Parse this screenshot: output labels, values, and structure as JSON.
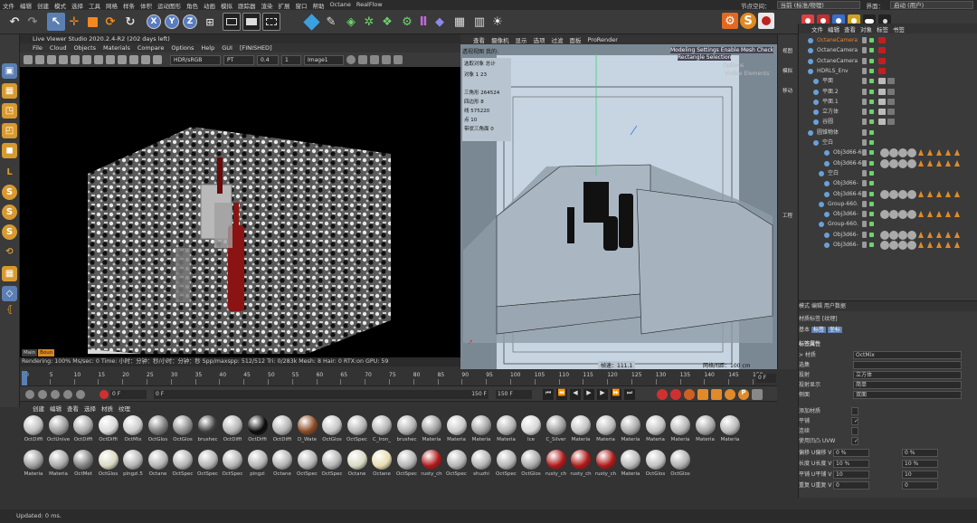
{
  "menubar": {
    "items": [
      "文件",
      "编辑",
      "创建",
      "模式",
      "选择",
      "工具",
      "网格",
      "样条",
      "体积",
      "运动图形",
      "角色",
      "动画",
      "模拟",
      "跟踪器",
      "渲染",
      "扩展",
      "窗口",
      "帮助",
      "Octane",
      "RealFlow"
    ],
    "node_space_label": "节点空间：",
    "node_space_value": "当前 (标准/物理)",
    "interface_label": "界面：",
    "interface_value": "启动 (用户)"
  },
  "toolbar": {
    "icons": [
      "undo-icon",
      "redo-icon",
      "select-icon",
      "move-icon",
      "scale-icon",
      "rotate-icon",
      "recent-tool-icon",
      "x-axis-icon",
      "y-axis-icon",
      "z-axis-icon",
      "coord-system-icon",
      "render-region-icon",
      "render-view-icon",
      "render-settings-icon",
      "cube-icon",
      "pen-icon",
      "subdivision-icon",
      "array-icon",
      "extrude-icon",
      "bend-icon",
      "deformer-icon",
      "floor-icon",
      "camera-icon",
      "light-icon"
    ],
    "axis_x": "X",
    "axis_y": "Y",
    "axis_z": "Z"
  },
  "live_viewer": {
    "title": "Live Viewer Studio 2020.2.4-R2 (202 days left)",
    "menu": [
      "File",
      "Cloud",
      "Objects",
      "Materials",
      "Compare",
      "Options",
      "Help",
      "GUI",
      "[FINISHED]"
    ],
    "color_space": "HDR/sRGB",
    "kernel": "PT",
    "value_a": "0.4",
    "value_b": "1",
    "image_mode": "Image1",
    "tabs": [
      "Main",
      "Boun"
    ],
    "status": "Rendering: 100%   Ms/sec: 0   Time: 小时：分钟：秒/小时：分钟：秒   Spp/maxspp: 512/512   Tri: 0/283k   Mesh: 8   Hair: 0   RTX:on   GPU:   59"
  },
  "viewport": {
    "menu": [
      "查看",
      "摄像机",
      "显示",
      "选项",
      "过滤",
      "面板",
      "ProRender"
    ],
    "view_label": "透视视图",
    "camera_label": "我的:",
    "hud_top": "Modeling Settings Enable Mesh Check",
    "hud_top2": "Rectangle Selection",
    "hud_faded1": "Options",
    "hud_faded2": "Visible Elements",
    "stats": [
      {
        "label": "选取对象",
        "value": "总计"
      },
      {
        "label": "对象",
        "value": "1          23"
      },
      {
        "label": "三角形",
        "value": "264524"
      },
      {
        "label": "四边形",
        "value": "8"
      },
      {
        "label": "线",
        "value": "575220"
      },
      {
        "label": "点",
        "value": "10"
      },
      {
        "label": "带状三角面",
        "value": "0"
      }
    ],
    "speed": "帧速：111.1",
    "grid_spacing": "网格间距：100 cm"
  },
  "viewport_side": [
    "视图",
    "模拟",
    "移动",
    "工程"
  ],
  "object_manager": {
    "tabs": [
      "文件",
      "编辑",
      "查看",
      "对象",
      "标签",
      "书签"
    ],
    "objects": [
      {
        "name": "OctaneCamera",
        "color": "#e8822a",
        "indent": 12
      },
      {
        "name": "OctaneCamera",
        "color": "#cfcfcf",
        "indent": 12
      },
      {
        "name": "OctaneCamera",
        "color": "#cfcfcf",
        "indent": 12
      },
      {
        "name": "HDRLS_Env",
        "color": "#cfcfcf",
        "indent": 12
      },
      {
        "name": "平面",
        "color": "#cfcfcf",
        "indent": 18
      },
      {
        "name": "平面.2",
        "color": "#cfcfcf",
        "indent": 18
      },
      {
        "name": "平面.1",
        "color": "#cfcfcf",
        "indent": 18
      },
      {
        "name": "立方体",
        "color": "#cfcfcf",
        "indent": 18
      },
      {
        "name": "谷圆",
        "color": "#cfcfcf",
        "indent": 18
      },
      {
        "name": "圆锥物体",
        "color": "#cfcfcf",
        "indent": 12
      },
      {
        "name": "空白",
        "color": "#cfcfcf",
        "indent": 18
      },
      {
        "name": "Obj3d66-6€",
        "color": "#cfcfcf",
        "indent": 30
      },
      {
        "name": "Obj3d66-6€",
        "color": "#cfcfcf",
        "indent": 30
      },
      {
        "name": "空白",
        "color": "#cfcfcf",
        "indent": 24
      },
      {
        "name": "Obj3d66-",
        "color": "#cfcfcf",
        "indent": 30
      },
      {
        "name": "Obj3d66-6€",
        "color": "#cfcfcf",
        "indent": 30
      },
      {
        "name": "Group-660.",
        "color": "#cfcfcf",
        "indent": 24
      },
      {
        "name": "Obj3d66-",
        "color": "#cfcfcf",
        "indent": 30
      },
      {
        "name": "Group-660.",
        "color": "#cfcfcf",
        "indent": 24
      },
      {
        "name": "Obj3d66-",
        "color": "#cfcfcf",
        "indent": 30
      },
      {
        "name": "Obj3d66-",
        "color": "#cfcfcf",
        "indent": 30
      }
    ]
  },
  "attributes": {
    "menu": [
      "模式",
      "编辑",
      "用户数据"
    ],
    "title": "材质标签 [纹理]",
    "tabs": [
      "基本",
      "标签",
      "坐标"
    ],
    "section": "标签属性",
    "fields": [
      {
        "label": "> 材质",
        "value": "OctMix"
      },
      {
        "label": "选集",
        "value": ""
      },
      {
        "label": "投射",
        "value": "立方体"
      },
      {
        "label": "投射显示",
        "value": "简单"
      },
      {
        "label": "侧面",
        "value": "双面"
      }
    ],
    "checks": [
      {
        "label": "添加材质",
        "checked": false
      },
      {
        "label": "平铺",
        "checked": true
      },
      {
        "label": "连续",
        "checked": false
      },
      {
        "label": "使用凹凸 UVW",
        "checked": true
      }
    ],
    "pairs": [
      {
        "la": "偏移 U",
        "va": "0 %",
        "lb": "偏移 V",
        "vb": "0 %"
      },
      {
        "la": "长度 U",
        "va": "10 %",
        "lb": "长度 V",
        "vb": "10 %"
      },
      {
        "la": "平铺 U",
        "va": "10",
        "lb": "平铺 V",
        "vb": "10"
      },
      {
        "la": "重复 U",
        "va": "0",
        "lb": "重复 V",
        "vb": "0"
      }
    ]
  },
  "timeline": {
    "ticks": [
      "0",
      "5",
      "10",
      "15",
      "20",
      "25",
      "30",
      "35",
      "40",
      "45",
      "50",
      "55",
      "60",
      "65",
      "70",
      "75",
      "80",
      "85",
      "90",
      "95",
      "100",
      "105",
      "110",
      "115",
      "120",
      "125",
      "130",
      "135",
      "140",
      "145",
      "150"
    ],
    "frame_end": "0 F",
    "current_frame": "0 F",
    "start_field": "0 F",
    "end_field": "150 F",
    "end_field2": "150 F"
  },
  "material_manager": {
    "menu": [
      "创建",
      "编辑",
      "查看",
      "选择",
      "材质",
      "纹理"
    ],
    "row1": [
      {
        "label": "OctDiffi",
        "color": "#bdbdbd"
      },
      {
        "label": "OctUnive",
        "color": "#9a9a9a"
      },
      {
        "label": "OctDiffi",
        "color": "#a8a8a8"
      },
      {
        "label": "OctDiffi",
        "color": "#d8d8d8"
      },
      {
        "label": "OctMix",
        "color": "#cacaca"
      },
      {
        "label": "OctGlos",
        "color": "#7a7a7a"
      },
      {
        "label": "OctGlos",
        "color": "#8c8c8c"
      },
      {
        "label": "brushec",
        "color": "#3c3c3c"
      },
      {
        "label": "OctDiffi",
        "color": "#b3b3b3"
      },
      {
        "label": "OctDiffi",
        "color": "#0a0a0a"
      },
      {
        "label": "OctDiffi",
        "color": "#b3b3b3"
      },
      {
        "label": "D_Wate",
        "color": "#8a4a22"
      },
      {
        "label": "OctGlos",
        "color": "#c4c4c4"
      },
      {
        "label": "OctSpec",
        "color": "#b3b3b3"
      },
      {
        "label": "C_Iron_",
        "color": "#b3b3b3"
      },
      {
        "label": "brushec",
        "color": "#b0b0b0"
      },
      {
        "label": "Materia",
        "color": "#9c9c9c"
      },
      {
        "label": "Materia",
        "color": "#c8c8c8"
      },
      {
        "label": "Materia",
        "color": "#a0a0a0"
      },
      {
        "label": "Materia",
        "color": "#b0b0b0"
      },
      {
        "label": "Ice",
        "color": "#d6d6d6"
      },
      {
        "label": "C_Silver",
        "color": "#9a9a9a"
      },
      {
        "label": "Materia",
        "color": "#c0c0c0"
      },
      {
        "label": "Materia",
        "color": "#b8b8b8"
      },
      {
        "label": "Materia",
        "color": "#a8a8a8"
      },
      {
        "label": "Materia",
        "color": "#c0c0c0"
      },
      {
        "label": "Materia",
        "color": "#b4b4b4"
      },
      {
        "label": "Materia",
        "color": "#a4a4a4"
      },
      {
        "label": "Materia",
        "color": "#b8b8b8"
      }
    ],
    "row2": [
      {
        "label": "Materia",
        "color": "#9c9c9c"
      },
      {
        "label": "Materia",
        "color": "#a8a8a8"
      },
      {
        "label": "OctMet",
        "color": "#808080"
      },
      {
        "label": "OctGlos",
        "color": "#d8d8c0"
      },
      {
        "label": "pingzi.5",
        "color": "#b3b3b3"
      },
      {
        "label": "Octane",
        "color": "#b3b3b3"
      },
      {
        "label": "OctSpec",
        "color": "#b3b3b3"
      },
      {
        "label": "OctSpec",
        "color": "#b3b3b3"
      },
      {
        "label": "OctSpec",
        "color": "#b3b3b3"
      },
      {
        "label": "pingzi",
        "color": "#b3b3b3"
      },
      {
        "label": "Octane",
        "color": "#b3b3b3"
      },
      {
        "label": "OctSpec",
        "color": "#b3b3b3"
      },
      {
        "label": "OctSpec",
        "color": "#b3b3b3"
      },
      {
        "label": "Octane",
        "color": "#d8d8c4"
      },
      {
        "label": "Octane",
        "color": "#e8dcb0"
      },
      {
        "label": "OctSpec",
        "color": "#b3b3b3"
      },
      {
        "label": "rusty_ch",
        "color": "#b01818"
      },
      {
        "label": "OctSpec",
        "color": "#b3b3b3"
      },
      {
        "label": "shuzhi",
        "color": "#b3b3b3"
      },
      {
        "label": "OctSpec",
        "color": "#b3b3b3"
      },
      {
        "label": "OctGlos",
        "color": "#a8a8a8"
      },
      {
        "label": "rusty_ch",
        "color": "#b01818"
      },
      {
        "label": "rusty_ch",
        "color": "#b01818"
      },
      {
        "label": "rusty_ch",
        "color": "#b01818"
      },
      {
        "label": "Materia",
        "color": "#b8b8b8"
      },
      {
        "label": "OctGlos",
        "color": "#c0c0c0"
      },
      {
        "label": "OctGlos",
        "color": "#b0b0b0"
      }
    ]
  },
  "statusbar": {
    "text": "Updated: 0 ms."
  }
}
